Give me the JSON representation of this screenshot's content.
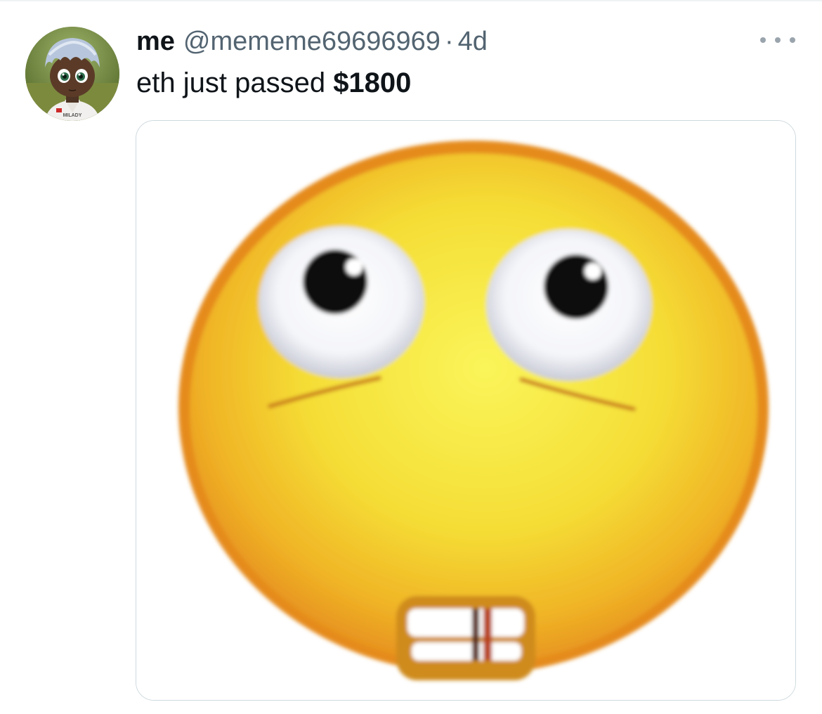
{
  "tweet": {
    "display_name": "me",
    "handle": "@mememe69696969",
    "separator": "·",
    "time": "4d",
    "text_plain": "eth just passed ",
    "text_bold": "$1800",
    "avatar_shirt_text": "MILADY",
    "more_icon": "more-horizontal-icon",
    "media_description": "emoji"
  },
  "colors": {
    "text_primary": "#0f1419",
    "text_secondary": "#536471",
    "border": "#cfd9de",
    "emoji_yellow": "#f6e43a",
    "emoji_orange": "#e08a1e"
  }
}
